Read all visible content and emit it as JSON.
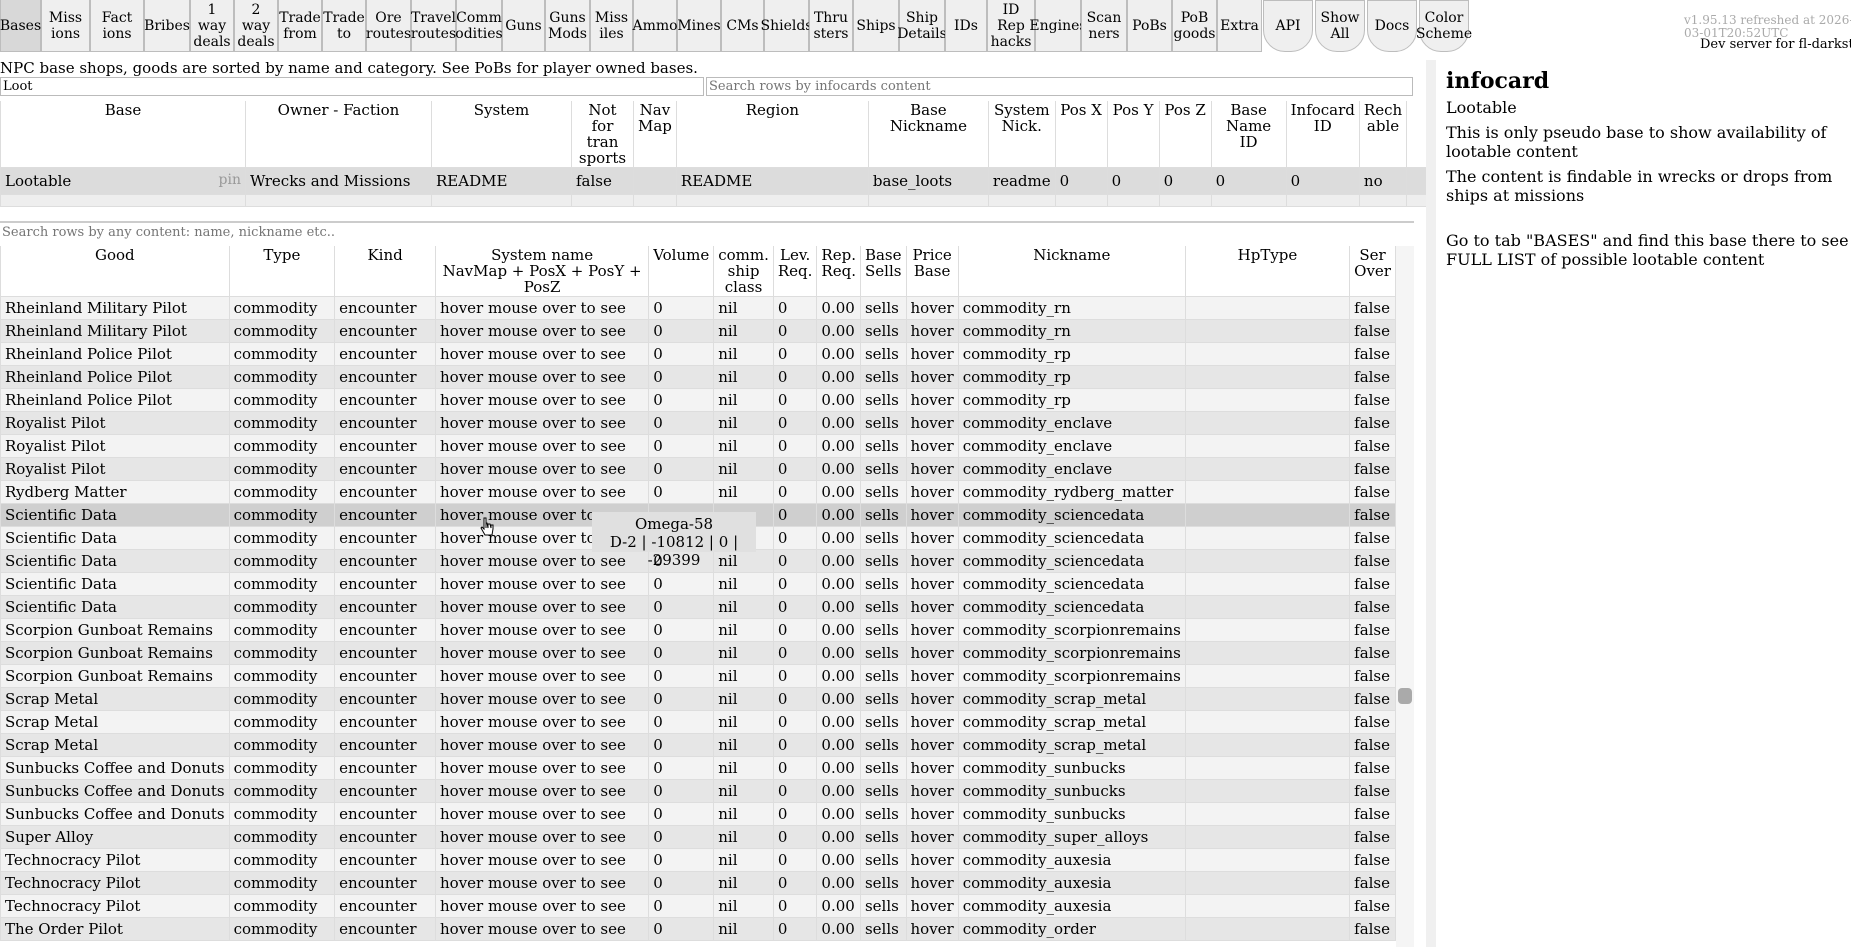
{
  "nav": {
    "tabs": [
      "Bases",
      "Miss\nions",
      "Fact\nions",
      "Bribes",
      "1 way\ndeals",
      "2 way\ndeals",
      "Trade\nfrom",
      "Trade\nto",
      "Ore\nroutes",
      "Travel\nroutes",
      "Comm\nodities",
      "Guns",
      "Guns\nMods",
      "Miss\niles",
      "Ammo",
      "Mines",
      "CMs",
      "Shields",
      "Thru\nsters",
      "Ships",
      "Ship\nDetails",
      "IDs",
      "ID\nRep\nhacks",
      "Engines",
      "Scan\nners",
      "PoBs",
      "PoB\ngoods",
      "Extra"
    ],
    "round_tabs": [
      "API",
      "Show\nAll",
      "Docs",
      "Color\nScheme"
    ],
    "version": "v1.95.13 refreshed at 2026-03-01T20:52UTC",
    "dev_server": "Dev server for fl-darkstat | C"
  },
  "intro_text": "NPC base shops, goods are sorted by name and category. See PoBs for player owned bases.",
  "search_bases": {
    "value": "Loot",
    "placeholder": ""
  },
  "search_infocards": {
    "placeholder": "Search rows by infocards content"
  },
  "search_goods": {
    "placeholder": "Search rows by any content: name, nickname etc.."
  },
  "bases_table": {
    "headers": [
      "Base",
      "Owner - Faction",
      "System",
      "Not for tran sports",
      "Nav Map",
      "Region",
      "Base Nickname",
      "System Nick.",
      "Pos X",
      "Pos Y",
      "Pos Z",
      "Base Name ID",
      "Infocard ID",
      "Rech able"
    ],
    "rows": [
      [
        "Lootable",
        "Wrecks and Missions",
        "README",
        "false",
        "",
        "README",
        "base_loots",
        "readme",
        "0",
        "0",
        "0",
        "0",
        "0",
        "no"
      ]
    ],
    "pin_label": "pin"
  },
  "goods_table": {
    "headers": [
      "Good",
      "Type",
      "Kind",
      "System name\nNavMap + PosX + PosY + PosZ",
      "Volume",
      "comm. ship class",
      "Lev. Req.",
      "Rep. Req.",
      "Base Sells",
      "Price Base",
      "Nickname",
      "HpType",
      "Ser Over"
    ],
    "rows": [
      [
        "Rheinland Military Pilot",
        "commodity",
        "encounter",
        "hover mouse over to see",
        "0",
        "nil",
        "0",
        "0.00",
        "sells",
        "hover",
        "commodity_rn",
        "",
        "false"
      ],
      [
        "Rheinland Military Pilot",
        "commodity",
        "encounter",
        "hover mouse over to see",
        "0",
        "nil",
        "0",
        "0.00",
        "sells",
        "hover",
        "commodity_rn",
        "",
        "false"
      ],
      [
        "Rheinland Police Pilot",
        "commodity",
        "encounter",
        "hover mouse over to see",
        "0",
        "nil",
        "0",
        "0.00",
        "sells",
        "hover",
        "commodity_rp",
        "",
        "false"
      ],
      [
        "Rheinland Police Pilot",
        "commodity",
        "encounter",
        "hover mouse over to see",
        "0",
        "nil",
        "0",
        "0.00",
        "sells",
        "hover",
        "commodity_rp",
        "",
        "false"
      ],
      [
        "Rheinland Police Pilot",
        "commodity",
        "encounter",
        "hover mouse over to see",
        "0",
        "nil",
        "0",
        "0.00",
        "sells",
        "hover",
        "commodity_rp",
        "",
        "false"
      ],
      [
        "Royalist Pilot",
        "commodity",
        "encounter",
        "hover mouse over to see",
        "0",
        "nil",
        "0",
        "0.00",
        "sells",
        "hover",
        "commodity_enclave",
        "",
        "false"
      ],
      [
        "Royalist Pilot",
        "commodity",
        "encounter",
        "hover mouse over to see",
        "0",
        "nil",
        "0",
        "0.00",
        "sells",
        "hover",
        "commodity_enclave",
        "",
        "false"
      ],
      [
        "Royalist Pilot",
        "commodity",
        "encounter",
        "hover mouse over to see",
        "0",
        "nil",
        "0",
        "0.00",
        "sells",
        "hover",
        "commodity_enclave",
        "",
        "false"
      ],
      [
        "Rydberg Matter",
        "commodity",
        "encounter",
        "hover mouse over to see",
        "0",
        "nil",
        "0",
        "0.00",
        "sells",
        "hover",
        "commodity_rydberg_matter",
        "",
        "false"
      ],
      [
        "Scientific Data",
        "commodity",
        "encounter",
        "hover mouse over to see",
        "",
        "",
        "0",
        "0.00",
        "sells",
        "hover",
        "commodity_sciencedata",
        "",
        "false"
      ],
      [
        "Scientific Data",
        "commodity",
        "encounter",
        "hover mouse over to see",
        "",
        "",
        "0",
        "0.00",
        "sells",
        "hover",
        "commodity_sciencedata",
        "",
        "false"
      ],
      [
        "Scientific Data",
        "commodity",
        "encounter",
        "hover mouse over to see",
        "0",
        "nil",
        "0",
        "0.00",
        "sells",
        "hover",
        "commodity_sciencedata",
        "",
        "false"
      ],
      [
        "Scientific Data",
        "commodity",
        "encounter",
        "hover mouse over to see",
        "0",
        "nil",
        "0",
        "0.00",
        "sells",
        "hover",
        "commodity_sciencedata",
        "",
        "false"
      ],
      [
        "Scientific Data",
        "commodity",
        "encounter",
        "hover mouse over to see",
        "0",
        "nil",
        "0",
        "0.00",
        "sells",
        "hover",
        "commodity_sciencedata",
        "",
        "false"
      ],
      [
        "Scorpion Gunboat Remains",
        "commodity",
        "encounter",
        "hover mouse over to see",
        "0",
        "nil",
        "0",
        "0.00",
        "sells",
        "hover",
        "commodity_scorpionremains",
        "",
        "false"
      ],
      [
        "Scorpion Gunboat Remains",
        "commodity",
        "encounter",
        "hover mouse over to see",
        "0",
        "nil",
        "0",
        "0.00",
        "sells",
        "hover",
        "commodity_scorpionremains",
        "",
        "false"
      ],
      [
        "Scorpion Gunboat Remains",
        "commodity",
        "encounter",
        "hover mouse over to see",
        "0",
        "nil",
        "0",
        "0.00",
        "sells",
        "hover",
        "commodity_scorpionremains",
        "",
        "false"
      ],
      [
        "Scrap Metal",
        "commodity",
        "encounter",
        "hover mouse over to see",
        "0",
        "nil",
        "0",
        "0.00",
        "sells",
        "hover",
        "commodity_scrap_metal",
        "",
        "false"
      ],
      [
        "Scrap Metal",
        "commodity",
        "encounter",
        "hover mouse over to see",
        "0",
        "nil",
        "0",
        "0.00",
        "sells",
        "hover",
        "commodity_scrap_metal",
        "",
        "false"
      ],
      [
        "Scrap Metal",
        "commodity",
        "encounter",
        "hover mouse over to see",
        "0",
        "nil",
        "0",
        "0.00",
        "sells",
        "hover",
        "commodity_scrap_metal",
        "",
        "false"
      ],
      [
        "Sunbucks Coffee and Donuts",
        "commodity",
        "encounter",
        "hover mouse over to see",
        "0",
        "nil",
        "0",
        "0.00",
        "sells",
        "hover",
        "commodity_sunbucks",
        "",
        "false"
      ],
      [
        "Sunbucks Coffee and Donuts",
        "commodity",
        "encounter",
        "hover mouse over to see",
        "0",
        "nil",
        "0",
        "0.00",
        "sells",
        "hover",
        "commodity_sunbucks",
        "",
        "false"
      ],
      [
        "Sunbucks Coffee and Donuts",
        "commodity",
        "encounter",
        "hover mouse over to see",
        "0",
        "nil",
        "0",
        "0.00",
        "sells",
        "hover",
        "commodity_sunbucks",
        "",
        "false"
      ],
      [
        "Super Alloy",
        "commodity",
        "encounter",
        "hover mouse over to see",
        "0",
        "nil",
        "0",
        "0.00",
        "sells",
        "hover",
        "commodity_super_alloys",
        "",
        "false"
      ],
      [
        "Technocracy Pilot",
        "commodity",
        "encounter",
        "hover mouse over to see",
        "0",
        "nil",
        "0",
        "0.00",
        "sells",
        "hover",
        "commodity_auxesia",
        "",
        "false"
      ],
      [
        "Technocracy Pilot",
        "commodity",
        "encounter",
        "hover mouse over to see",
        "0",
        "nil",
        "0",
        "0.00",
        "sells",
        "hover",
        "commodity_auxesia",
        "",
        "false"
      ],
      [
        "Technocracy Pilot",
        "commodity",
        "encounter",
        "hover mouse over to see",
        "0",
        "nil",
        "0",
        "0.00",
        "sells",
        "hover",
        "commodity_auxesia",
        "",
        "false"
      ],
      [
        "The Order Pilot",
        "commodity",
        "encounter",
        "hover mouse over to see",
        "0",
        "nil",
        "0",
        "0.00",
        "sells",
        "hover",
        "commodity_order",
        "",
        "false"
      ]
    ],
    "highlighted_row": 9
  },
  "tooltip": {
    "line1": "Omega-58",
    "line2": "D-2 | -10812 | 0 | -29399"
  },
  "infocard": {
    "title": "infocard",
    "lines": [
      "Lootable",
      "This is only pseudo base to show availability of lootable content",
      "The content is findable in wrecks or drops from ships at missions",
      "",
      "Go to tab \"BASES\" and find this base there to see FULL LIST of possible lootable content"
    ]
  }
}
